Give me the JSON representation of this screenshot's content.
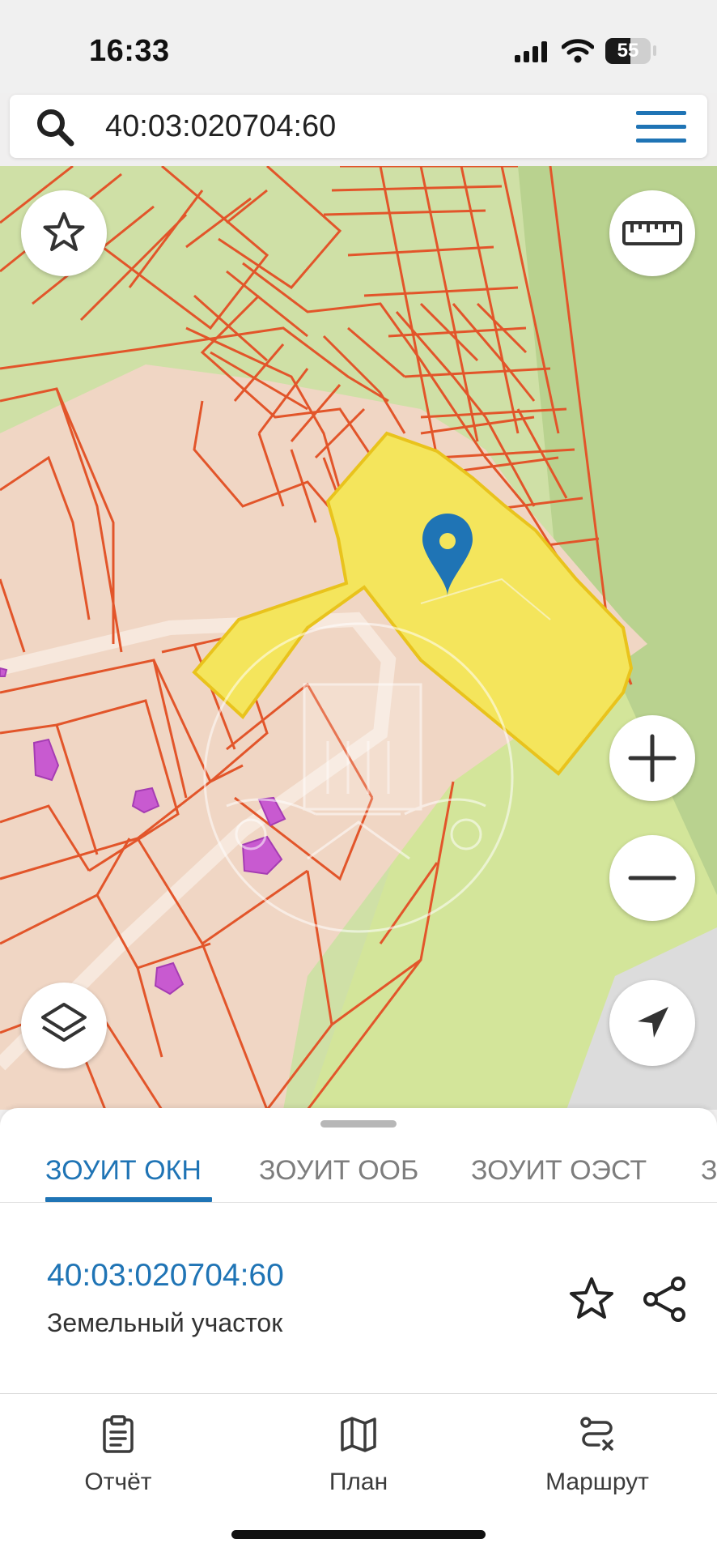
{
  "status_bar": {
    "time": "16:33",
    "battery_level": "55",
    "battery_fraction": 0.55,
    "icons": [
      "signal-icon",
      "wifi-icon",
      "battery-icon"
    ]
  },
  "search": {
    "value": "40:03:020704:60",
    "icon": "search-icon",
    "menu_icon": "hamburger-menu-icon"
  },
  "map": {
    "controls": {
      "favorite": "star-icon",
      "ruler": "ruler-icon",
      "zoom_in": "plus-icon",
      "zoom_out": "minus-icon",
      "layers": "layers-icon",
      "locate": "navigation-arrow-icon"
    },
    "colors": {
      "parcel_border": "#e2552a",
      "selected_parcel": "#f4e55c",
      "green_area": "#c9dba0",
      "pink_area": "#f0d6c4",
      "marker": "#1f74b5"
    }
  },
  "panel": {
    "tabs": [
      {
        "label": "ЗОУИТ ОКН",
        "active": true
      },
      {
        "label": "ЗОУИТ ООБ",
        "active": false
      },
      {
        "label": "ЗОУИТ ОЭСТ",
        "active": false
      },
      {
        "label": "З",
        "active": false
      }
    ],
    "cadastral_number": "40:03:020704:60",
    "object_type": "Земельный участок",
    "accent_color": "#1f74b5"
  },
  "bottom_nav": {
    "items": [
      {
        "label": "Отчёт",
        "icon": "report-clipboard-icon"
      },
      {
        "label": "План",
        "icon": "map-plan-icon"
      },
      {
        "label": "Маршрут",
        "icon": "route-icon"
      }
    ]
  }
}
